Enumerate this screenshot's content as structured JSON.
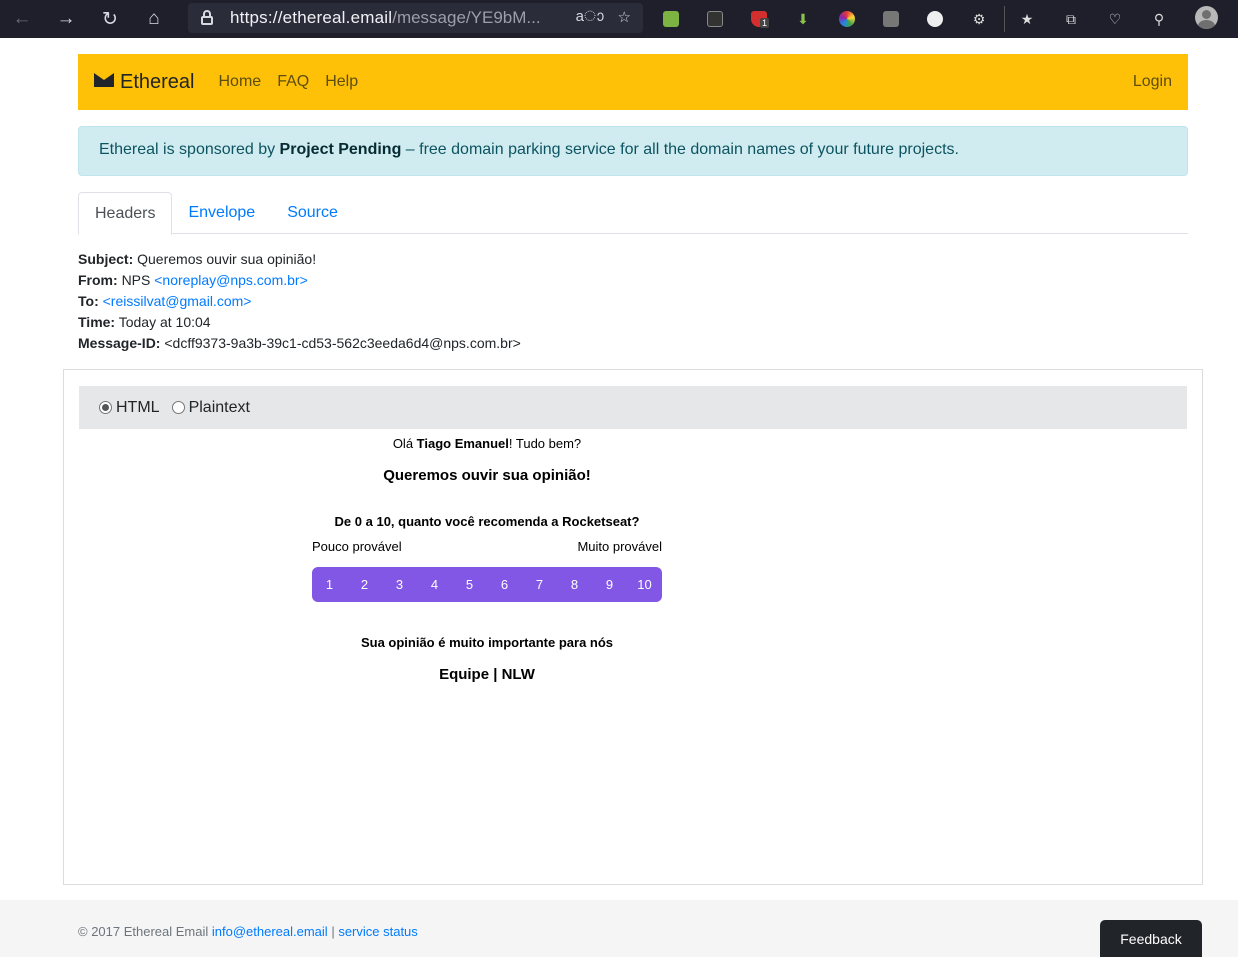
{
  "browser": {
    "url_host": "https://ethereal.email",
    "url_path": "/message/YE9bM...",
    "extension_badge": "1"
  },
  "navbar": {
    "brand": "Ethereal",
    "links": [
      "Home",
      "FAQ",
      "Help"
    ],
    "login": "Login"
  },
  "alert": {
    "prefix": "Ethereal is sponsored by ",
    "sponsor": "Project Pending",
    "suffix": " – free domain parking service for all the domain names of your future projects."
  },
  "tabs": [
    "Headers",
    "Envelope",
    "Source"
  ],
  "headers": {
    "subject_label": "Subject:",
    "subject": "Queremos ouvir sua opinião!",
    "from_label": "From:",
    "from_name": "NPS",
    "from_email": "<noreplay@nps.com.br>",
    "to_label": "To:",
    "to_email": "<reissilvat@gmail.com>",
    "time_label": "Time:",
    "time": "Today at 10:04",
    "message_id_label": "Message-ID:",
    "message_id": "<dcff9373-9a3b-39c1-cd53-562c3eeda6d4@nps.com.br>"
  },
  "view_options": {
    "html": "HTML",
    "plaintext": "Plaintext",
    "selected": "HTML"
  },
  "email": {
    "greeting_prefix": "Olá ",
    "greeting_name": "Tiago Emanuel",
    "greeting_suffix": "! Tudo bem?",
    "title": "Queremos ouvir sua opinião!",
    "question": "De 0 a 10, quanto você recomenda a Rocketseat?",
    "scale_low": "Pouco provável",
    "scale_high": "Muito provável",
    "scores": [
      "1",
      "2",
      "3",
      "4",
      "5",
      "6",
      "7",
      "8",
      "9",
      "10"
    ],
    "closing": "Sua opinião é muito importante para nós",
    "signature": "Equipe | NLW",
    "button_color": "#8257e5"
  },
  "footer": {
    "copyright": "© 2017 Ethereal Email ",
    "email_link": "info@ethereal.email",
    "separator": " | ",
    "status_link": "service status",
    "feedback": "Feedback"
  },
  "colors": {
    "navbar": "#ffc107",
    "alert_bg": "#d1ecf1",
    "link": "#007bff"
  }
}
